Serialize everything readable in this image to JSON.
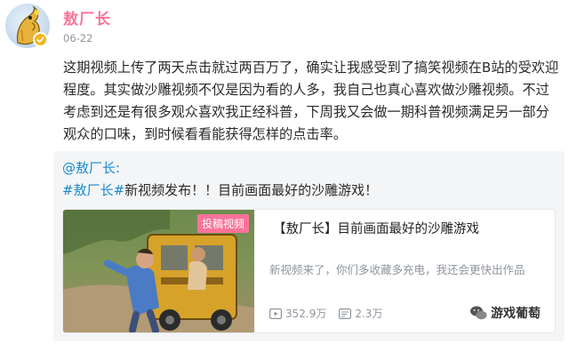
{
  "post": {
    "author": "敖厂长",
    "date": "06-22",
    "text": "这期视频上传了两天点击就过两百万了，确实让我感受到了搞笑视频在B站的受欢迎程度。其实做沙雕视频不仅是因为看的人多，我自己也真心喜欢做沙雕视频。不过考虑到还是有很多观众喜欢我正经科普，下周我又会做一期科普视频满足另一部分观众的口味，到时候看看能获得怎样的点击率。"
  },
  "repost": {
    "author": "@敖厂长:",
    "hashtag": "#敖厂长#",
    "text": "新视频发布！！目前画面最好的沙雕游戏！"
  },
  "video": {
    "badge": "投稿视频",
    "title": "【敖厂长】目前画面最好的沙雕游戏",
    "description": "新视频来了，你们多收藏多充电，我还会更快出作品",
    "views": "352.9万",
    "comments": "2.3万"
  },
  "watermark": {
    "text": "游戏葡萄"
  },
  "colors": {
    "username": "#fb7299",
    "link": "#178bcf",
    "badge": "#fb7299",
    "muted": "#8f959c"
  }
}
